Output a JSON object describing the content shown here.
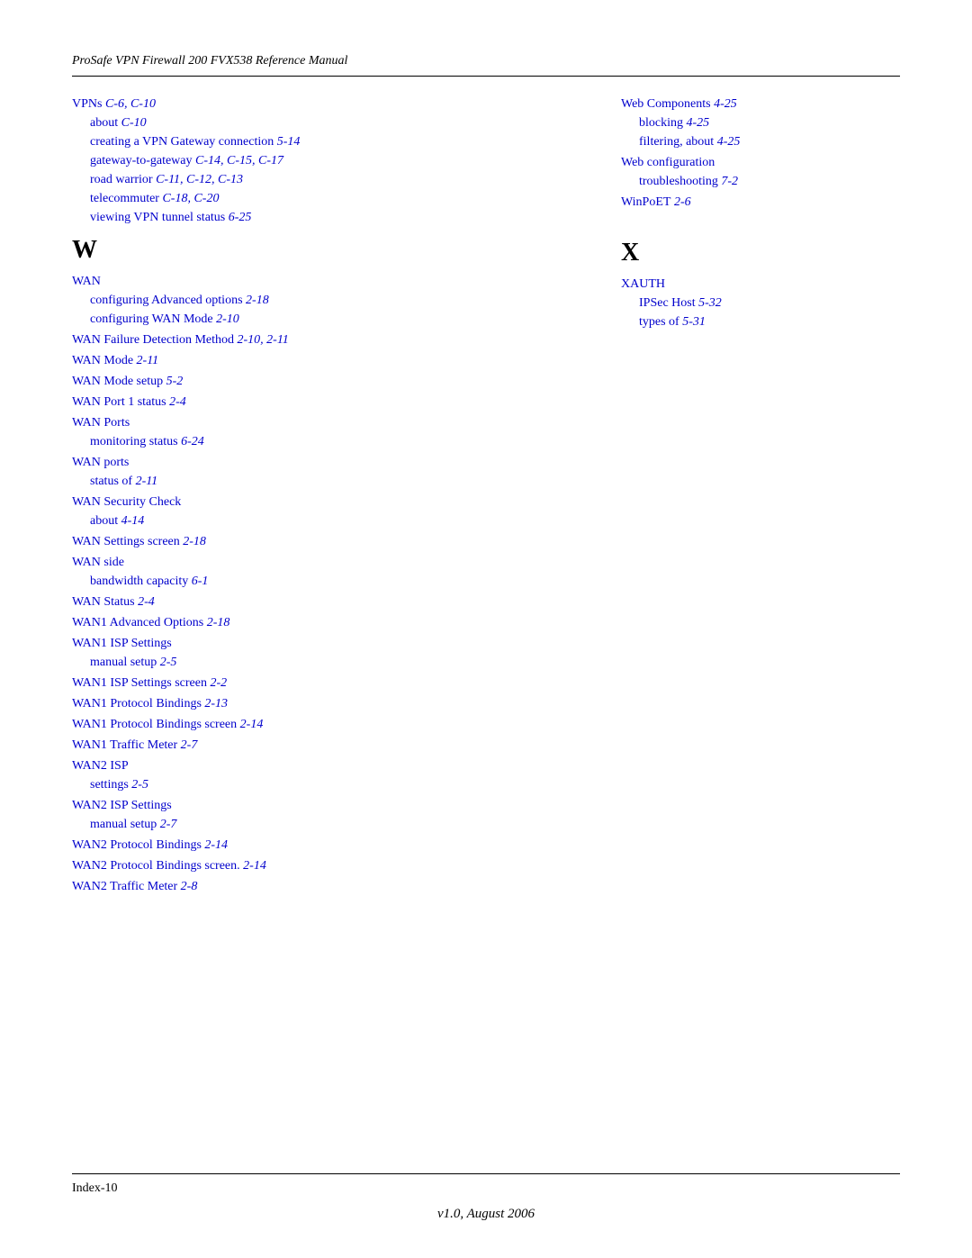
{
  "header": {
    "title": "ProSafe VPN Firewall 200 FVX538 Reference Manual"
  },
  "footer": {
    "index_label": "Index-10",
    "version": "v1.0, August 2006"
  },
  "left_section": {
    "letter": "W",
    "entries": [
      {
        "id": "vpns",
        "main_text": "VPNs",
        "main_ref": "C-6, C-10",
        "subs": [
          {
            "text": "about",
            "ref": "C-10"
          },
          {
            "text": "creating a VPN Gateway connection",
            "ref": "5-14"
          },
          {
            "text": "gateway-to-gateway",
            "ref": "C-14, C-15, C-17"
          },
          {
            "text": "road warrior",
            "ref": "C-11, C-12, C-13"
          },
          {
            "text": "telecommuter",
            "ref": "C-18, C-20"
          },
          {
            "text": "viewing VPN tunnel status",
            "ref": "6-25"
          }
        ]
      },
      {
        "id": "wan",
        "main_text": "WAN",
        "main_ref": "",
        "subs": [
          {
            "text": "configuring Advanced options",
            "ref": "2-18"
          },
          {
            "text": "configuring WAN Mode",
            "ref": "2-10"
          }
        ]
      },
      {
        "id": "wan-failure",
        "main_text": "WAN Failure Detection Method",
        "main_ref": "2-10, 2-11",
        "subs": []
      },
      {
        "id": "wan-mode",
        "main_text": "WAN Mode",
        "main_ref": "2-11",
        "subs": []
      },
      {
        "id": "wan-mode-setup",
        "main_text": "WAN Mode setup",
        "main_ref": "5-2",
        "subs": []
      },
      {
        "id": "wan-port1-status",
        "main_text": "WAN Port 1 status",
        "main_ref": "2-4",
        "subs": []
      },
      {
        "id": "wan-ports-cap",
        "main_text": "WAN Ports",
        "main_ref": "",
        "subs": [
          {
            "text": "monitoring status",
            "ref": "6-24"
          }
        ]
      },
      {
        "id": "wan-ports-lower",
        "main_text": "WAN ports",
        "main_ref": "",
        "subs": [
          {
            "text": "status of",
            "ref": "2-11"
          }
        ]
      },
      {
        "id": "wan-security",
        "main_text": "WAN Security Check",
        "main_ref": "",
        "subs": [
          {
            "text": "about",
            "ref": "4-14"
          }
        ]
      },
      {
        "id": "wan-settings-screen",
        "main_text": "WAN Settings screen",
        "main_ref": "2-18",
        "subs": []
      },
      {
        "id": "wan-side",
        "main_text": "WAN side",
        "main_ref": "",
        "subs": [
          {
            "text": "bandwidth capacity",
            "ref": "6-1"
          }
        ]
      },
      {
        "id": "wan-status",
        "main_text": "WAN Status",
        "main_ref": "2-4",
        "subs": []
      },
      {
        "id": "wan1-advanced",
        "main_text": "WAN1 Advanced Options",
        "main_ref": "2-18",
        "subs": []
      },
      {
        "id": "wan1-isp-settings",
        "main_text": "WAN1 ISP Settings",
        "main_ref": "",
        "subs": [
          {
            "text": "manual setup",
            "ref": "2-5"
          }
        ]
      },
      {
        "id": "wan1-isp-screen",
        "main_text": "WAN1 ISP Settings screen",
        "main_ref": "2-2",
        "subs": []
      },
      {
        "id": "wan1-protocol",
        "main_text": "WAN1 Protocol Bindings",
        "main_ref": "2-13",
        "subs": []
      },
      {
        "id": "wan1-protocol-screen",
        "main_text": "WAN1 Protocol Bindings screen",
        "main_ref": "2-14",
        "subs": []
      },
      {
        "id": "wan1-traffic",
        "main_text": "WAN1 Traffic Meter",
        "main_ref": "2-7",
        "subs": []
      },
      {
        "id": "wan2-isp",
        "main_text": "WAN2 ISP",
        "main_ref": "",
        "subs": [
          {
            "text": "settings",
            "ref": "2-5"
          }
        ]
      },
      {
        "id": "wan2-isp-settings",
        "main_text": "WAN2 ISP Settings",
        "main_ref": "",
        "subs": [
          {
            "text": "manual setup",
            "ref": "2-7"
          }
        ]
      },
      {
        "id": "wan2-protocol",
        "main_text": "WAN2 Protocol Bindings",
        "main_ref": "2-14",
        "subs": []
      },
      {
        "id": "wan2-protocol-screen",
        "main_text": "WAN2 Protocol Bindings screen.",
        "main_ref": "2-14",
        "subs": []
      },
      {
        "id": "wan2-traffic",
        "main_text": "WAN2 Traffic Meter",
        "main_ref": "2-8",
        "subs": []
      }
    ]
  },
  "right_section": {
    "letter_x": "X",
    "entries_top": [
      {
        "id": "web-components",
        "main_text": "Web Components",
        "main_ref": "4-25",
        "subs": [
          {
            "text": "blocking",
            "ref": "4-25"
          },
          {
            "text": "filtering, about",
            "ref": "4-25"
          }
        ]
      },
      {
        "id": "web-configuration",
        "main_text": "Web configuration",
        "main_ref": "",
        "subs": [
          {
            "text": "troubleshooting",
            "ref": "7-2"
          }
        ]
      },
      {
        "id": "winpoet",
        "main_text": "WinPoET",
        "main_ref": "2-6",
        "subs": []
      }
    ],
    "entries_x": [
      {
        "id": "xauth",
        "main_text": "XAUTH",
        "main_ref": "",
        "subs": [
          {
            "text": "IPSec Host",
            "ref": "5-32"
          },
          {
            "text": "types of",
            "ref": "5-31"
          }
        ]
      }
    ]
  }
}
